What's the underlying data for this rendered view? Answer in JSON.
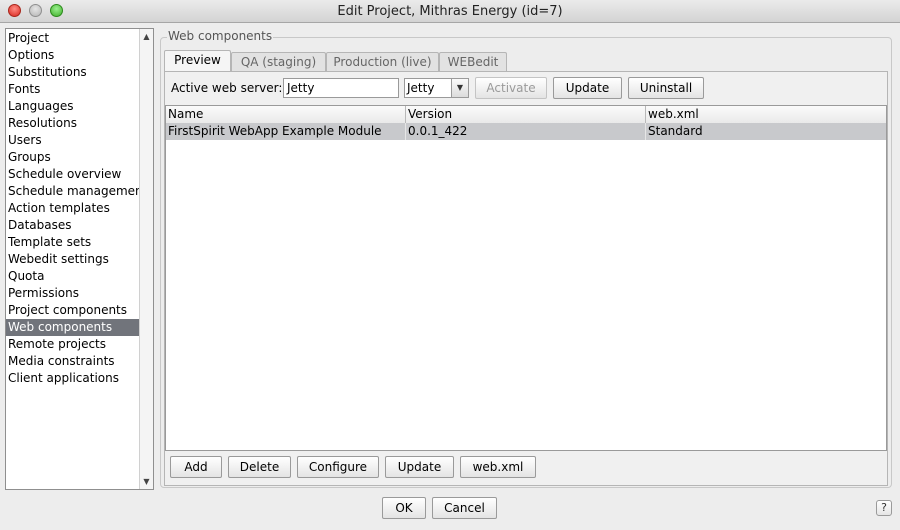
{
  "window": {
    "title": "Edit Project, Mithras Energy (id=7)"
  },
  "sidebar": {
    "items": [
      {
        "label": "Project"
      },
      {
        "label": "Options"
      },
      {
        "label": "Substitutions"
      },
      {
        "label": "Fonts"
      },
      {
        "label": "Languages"
      },
      {
        "label": "Resolutions"
      },
      {
        "label": "Users"
      },
      {
        "label": "Groups"
      },
      {
        "label": "Schedule overview"
      },
      {
        "label": "Schedule management"
      },
      {
        "label": "Action templates"
      },
      {
        "label": "Databases"
      },
      {
        "label": "Template sets"
      },
      {
        "label": "Webedit settings"
      },
      {
        "label": "Quota"
      },
      {
        "label": "Permissions"
      },
      {
        "label": "Project components"
      },
      {
        "label": "Web components",
        "selected": true
      },
      {
        "label": "Remote projects"
      },
      {
        "label": "Media constraints"
      },
      {
        "label": "Client applications"
      }
    ]
  },
  "group": {
    "label": "Web components"
  },
  "tabs": [
    {
      "label": "Preview",
      "active": true
    },
    {
      "label": "QA (staging)"
    },
    {
      "label": "Production (live)"
    },
    {
      "label": "WEBedit"
    }
  ],
  "server": {
    "label": "Active web server:",
    "value": "Jetty",
    "combo_value": "Jetty",
    "activate_label": "Activate",
    "update_label": "Update",
    "uninstall_label": "Uninstall"
  },
  "table": {
    "columns": [
      "Name",
      "Version",
      "web.xml"
    ],
    "rows": [
      [
        "FirstSpirit WebApp Example Module",
        "0.0.1_422",
        "Standard"
      ]
    ]
  },
  "table_buttons": {
    "add": "Add",
    "delete": "Delete",
    "configure": "Configure",
    "update": "Update",
    "webxml": "web.xml"
  },
  "dialog": {
    "ok": "OK",
    "cancel": "Cancel",
    "help": "?"
  },
  "colors": {
    "selection": "#71747b",
    "row_selected": "#c8c9cc"
  }
}
